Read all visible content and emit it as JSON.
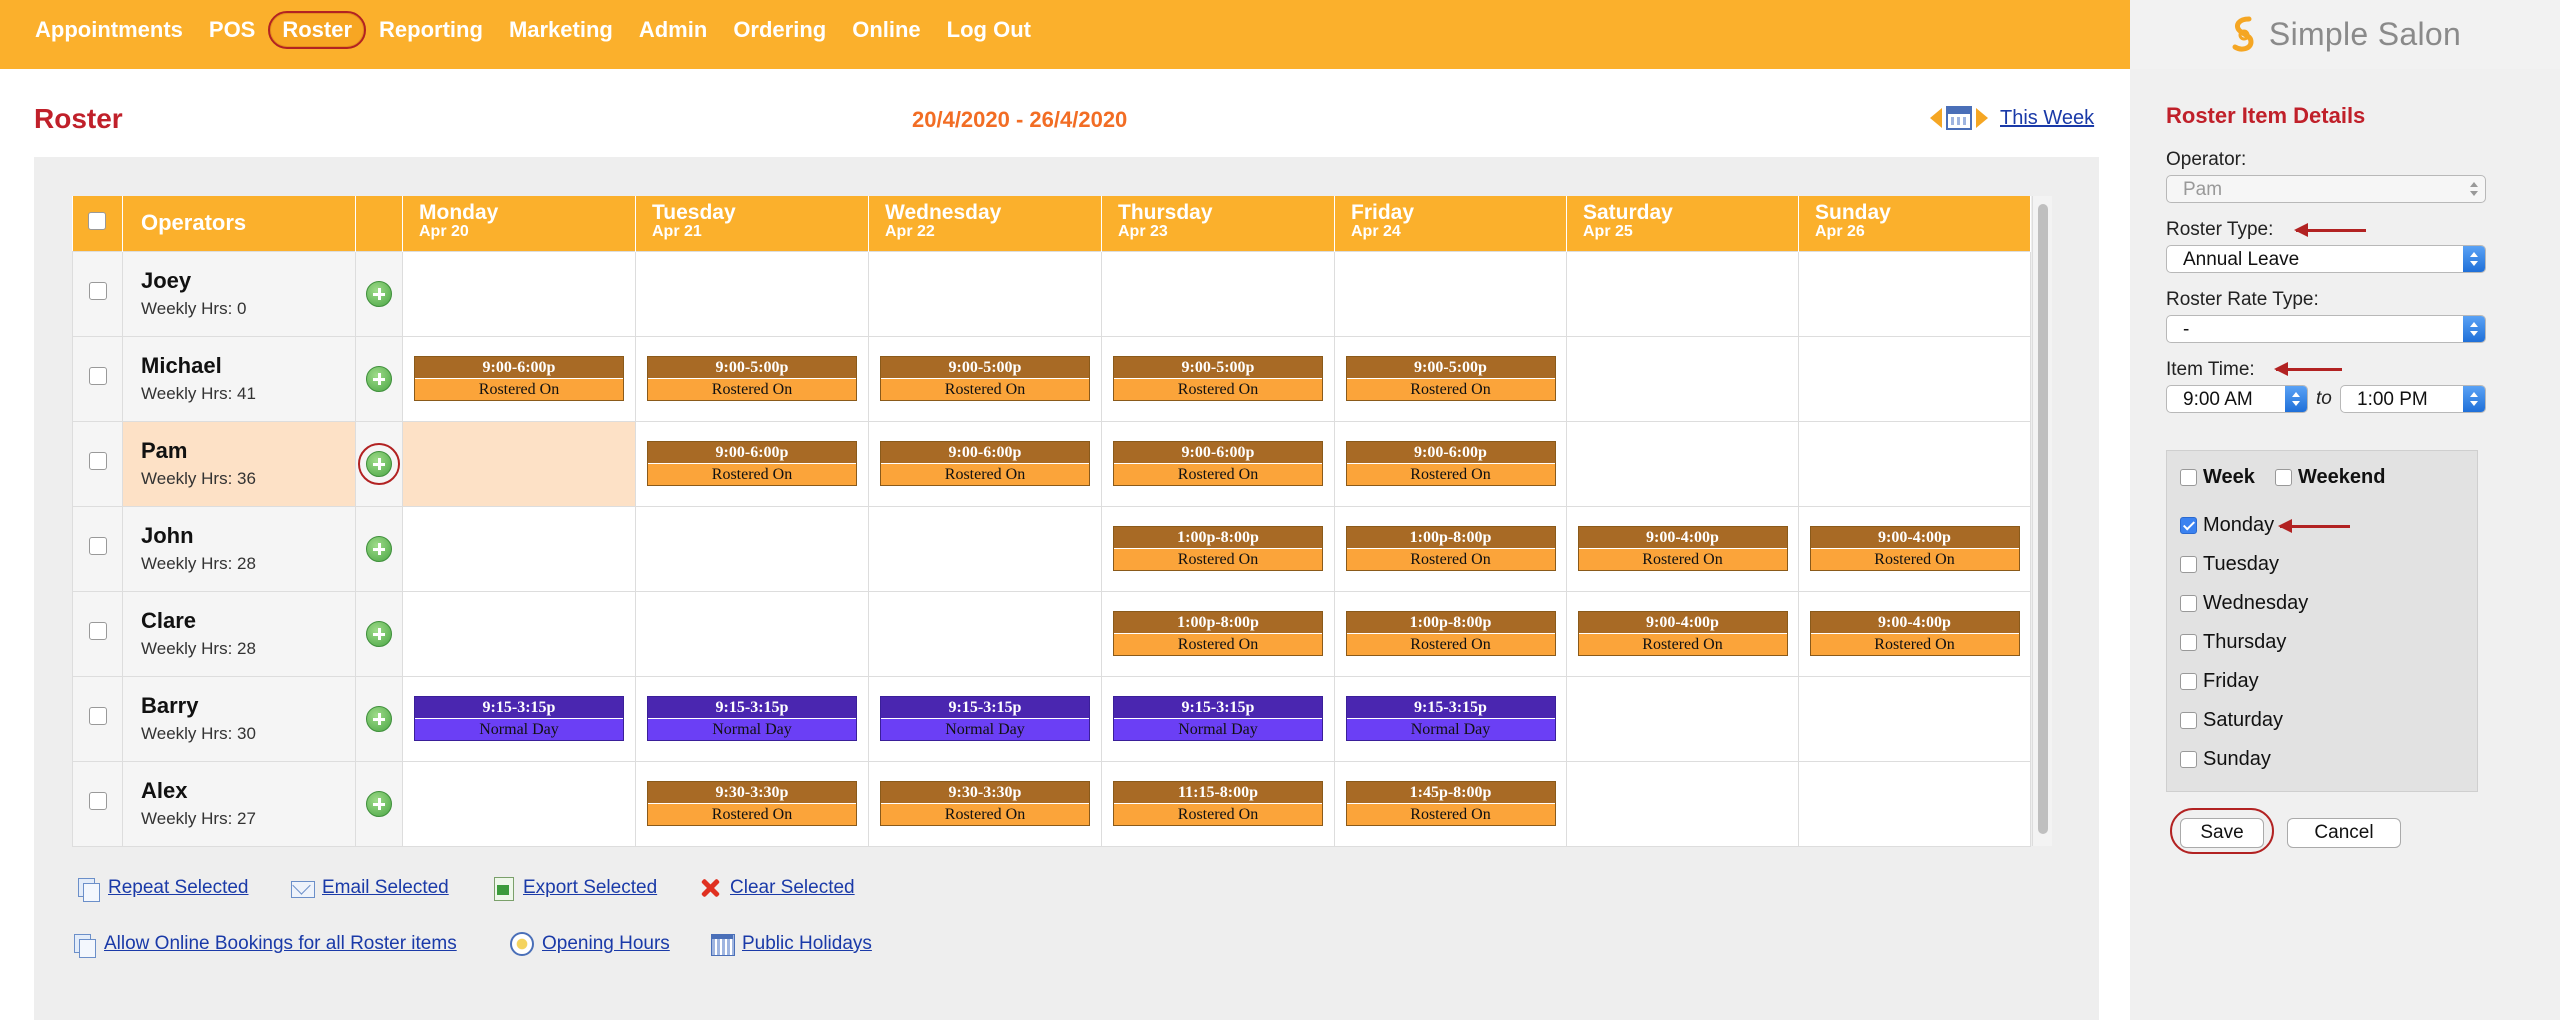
{
  "nav": {
    "items": [
      "Appointments",
      "POS",
      "Roster",
      "Reporting",
      "Marketing",
      "Admin",
      "Ordering",
      "Online",
      "Log Out"
    ],
    "active": "Roster"
  },
  "brand": {
    "name": "Simple Salon"
  },
  "header": {
    "title": "Roster",
    "date_range": "20/4/2020 - 26/4/2020",
    "this_week": "This Week"
  },
  "grid": {
    "operators_label": "Operators",
    "days": [
      {
        "name": "Monday",
        "date": "Apr 20"
      },
      {
        "name": "Tuesday",
        "date": "Apr 21"
      },
      {
        "name": "Wednesday",
        "date": "Apr 22"
      },
      {
        "name": "Thursday",
        "date": "Apr 23"
      },
      {
        "name": "Friday",
        "date": "Apr 24"
      },
      {
        "name": "Saturday",
        "date": "Apr 25"
      },
      {
        "name": "Sunday",
        "date": "Apr 26"
      }
    ],
    "rows": [
      {
        "name": "Joey",
        "hours": "Weekly Hrs: 0",
        "selected": false,
        "shifts": [
          null,
          null,
          null,
          null,
          null,
          null,
          null
        ]
      },
      {
        "name": "Michael",
        "hours": "Weekly Hrs: 41",
        "selected": false,
        "shifts": [
          {
            "time": "9:00-6:00p",
            "status": "Rostered On",
            "kind": "rostered"
          },
          {
            "time": "9:00-5:00p",
            "status": "Rostered On",
            "kind": "rostered"
          },
          {
            "time": "9:00-5:00p",
            "status": "Rostered On",
            "kind": "rostered"
          },
          {
            "time": "9:00-5:00p",
            "status": "Rostered On",
            "kind": "rostered"
          },
          {
            "time": "9:00-5:00p",
            "status": "Rostered On",
            "kind": "rostered"
          },
          null,
          null
        ]
      },
      {
        "name": "Pam",
        "hours": "Weekly Hrs: 36",
        "selected": true,
        "shifts": [
          null,
          {
            "time": "9:00-6:00p",
            "status": "Rostered On",
            "kind": "rostered"
          },
          {
            "time": "9:00-6:00p",
            "status": "Rostered On",
            "kind": "rostered"
          },
          {
            "time": "9:00-6:00p",
            "status": "Rostered On",
            "kind": "rostered"
          },
          {
            "time": "9:00-6:00p",
            "status": "Rostered On",
            "kind": "rostered"
          },
          null,
          null
        ]
      },
      {
        "name": "John",
        "hours": "Weekly Hrs: 28",
        "selected": false,
        "shifts": [
          null,
          null,
          null,
          {
            "time": "1:00p-8:00p",
            "status": "Rostered On",
            "kind": "rostered"
          },
          {
            "time": "1:00p-8:00p",
            "status": "Rostered On",
            "kind": "rostered"
          },
          {
            "time": "9:00-4:00p",
            "status": "Rostered On",
            "kind": "rostered"
          },
          {
            "time": "9:00-4:00p",
            "status": "Rostered On",
            "kind": "rostered"
          }
        ]
      },
      {
        "name": "Clare",
        "hours": "Weekly Hrs: 28",
        "selected": false,
        "shifts": [
          null,
          null,
          null,
          {
            "time": "1:00p-8:00p",
            "status": "Rostered On",
            "kind": "rostered"
          },
          {
            "time": "1:00p-8:00p",
            "status": "Rostered On",
            "kind": "rostered"
          },
          {
            "time": "9:00-4:00p",
            "status": "Rostered On",
            "kind": "rostered"
          },
          {
            "time": "9:00-4:00p",
            "status": "Rostered On",
            "kind": "rostered"
          }
        ]
      },
      {
        "name": "Barry",
        "hours": "Weekly Hrs: 30",
        "selected": false,
        "shifts": [
          {
            "time": "9:15-3:15p",
            "status": "Normal Day",
            "kind": "normal"
          },
          {
            "time": "9:15-3:15p",
            "status": "Normal Day",
            "kind": "normal"
          },
          {
            "time": "9:15-3:15p",
            "status": "Normal Day",
            "kind": "normal"
          },
          {
            "time": "9:15-3:15p",
            "status": "Normal Day",
            "kind": "normal"
          },
          {
            "time": "9:15-3:15p",
            "status": "Normal Day",
            "kind": "normal"
          },
          null,
          null
        ]
      },
      {
        "name": "Alex",
        "hours": "Weekly Hrs: 27",
        "selected": false,
        "shifts": [
          null,
          {
            "time": "9:30-3:30p",
            "status": "Rostered On",
            "kind": "rostered"
          },
          {
            "time": "9:30-3:30p",
            "status": "Rostered On",
            "kind": "rostered"
          },
          {
            "time": "11:15-8:00p",
            "status": "Rostered On",
            "kind": "rostered"
          },
          {
            "time": "1:45p-8:00p",
            "status": "Rostered On",
            "kind": "rostered"
          },
          null,
          null
        ]
      }
    ]
  },
  "actions": {
    "repeat": "Repeat Selected",
    "email": "Email Selected",
    "export": "Export Selected",
    "clear": "Clear Selected",
    "allow_online": "Allow Online Bookings for all Roster items",
    "opening_hours": "Opening Hours",
    "public_holidays": "Public Holidays"
  },
  "details": {
    "title": "Roster Item Details",
    "operator_label": "Operator:",
    "operator_value": "Pam",
    "roster_type_label": "Roster Type:",
    "roster_type_value": "Annual Leave",
    "rate_type_label": "Roster Rate Type:",
    "rate_type_value": "-",
    "item_time_label": "Item Time:",
    "time_from": "9:00 AM",
    "time_to_label": "to",
    "time_to": "1:00 PM",
    "week_label": "Week",
    "weekend_label": "Weekend",
    "days": [
      {
        "label": "Monday",
        "checked": true
      },
      {
        "label": "Tuesday",
        "checked": false
      },
      {
        "label": "Wednesday",
        "checked": false
      },
      {
        "label": "Thursday",
        "checked": false
      },
      {
        "label": "Friday",
        "checked": false
      },
      {
        "label": "Saturday",
        "checked": false
      },
      {
        "label": "Sunday",
        "checked": false
      }
    ],
    "save": "Save",
    "cancel": "Cancel"
  },
  "colors": {
    "nav_bg": "#fbb02c",
    "title_red": "#c0202a",
    "date_orange": "#f26d24",
    "rostered_top": "#a86a25",
    "rostered_bottom": "#fba43a",
    "normal_top": "#4a26b0",
    "normal_bottom": "#6b3ff5"
  }
}
